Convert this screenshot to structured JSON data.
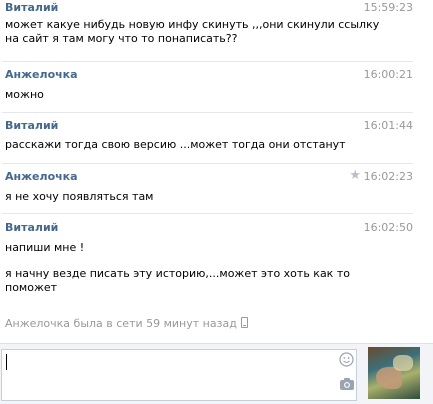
{
  "messages": [
    {
      "author": "Виталий",
      "time": "15:59:23",
      "lines": [
        "может какуе нибудь новую инфу скинуть ,,,они скинули ссылку на сайт я там могу что то понаписать??"
      ]
    },
    {
      "author": "Анжелочка",
      "time": "16:00:21",
      "lines": [
        "можно"
      ]
    },
    {
      "author": "Виталий",
      "time": "16:01:44",
      "lines": [
        "расскажи тогда свою версию ...может тогда они отстанут"
      ]
    },
    {
      "author": "Анжелочка",
      "time": "16:02:23",
      "lines": [
        "я не хочу появляться там"
      ],
      "star_icon": "star-icon"
    },
    {
      "author": "Виталий",
      "time": "16:02:50",
      "lines": [
        "напиши мне !",
        "я начну везде писать эту историю,...может это хоть как то поможет"
      ]
    }
  ],
  "status": {
    "text": "Анжелочка была в сети 59 минут назад",
    "icon": "mobile-phone-icon"
  },
  "composer": {
    "value": "",
    "smile_icon": "smile-icon",
    "camera_icon": "camera-icon",
    "avatar_icon": "avatar"
  },
  "colors": {
    "author": "#45688e",
    "time": "#999999",
    "separator": "#e4e8ed",
    "composer_bg": "#f2f4f7"
  }
}
